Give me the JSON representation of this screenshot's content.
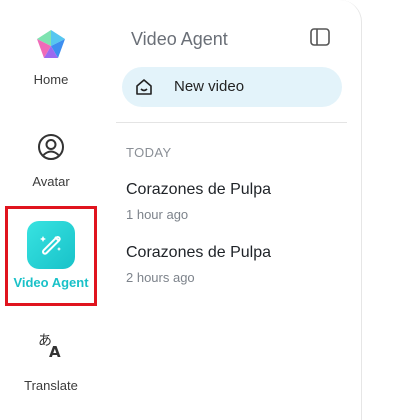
{
  "nav": {
    "items": [
      {
        "label": "Home",
        "icon": "brand-logo-icon"
      },
      {
        "label": "Avatar",
        "icon": "user-circle-icon"
      },
      {
        "label": "Video Agent",
        "icon": "magic-wand-icon",
        "active": true
      },
      {
        "label": "Translate",
        "icon": "translate-icon"
      }
    ],
    "active_color": "#19C1C8"
  },
  "panel": {
    "title": "Video Agent",
    "new_video_label": "New video",
    "section_label": "TODAY",
    "history": [
      {
        "title": "Corazones de Pulpa",
        "time": "1 hour ago"
      },
      {
        "title": "Corazones de Pulpa",
        "time": "2 hours ago"
      }
    ]
  },
  "colors": {
    "highlight_border": "#E0141E",
    "new_video_bg": "#E3F3FA"
  }
}
